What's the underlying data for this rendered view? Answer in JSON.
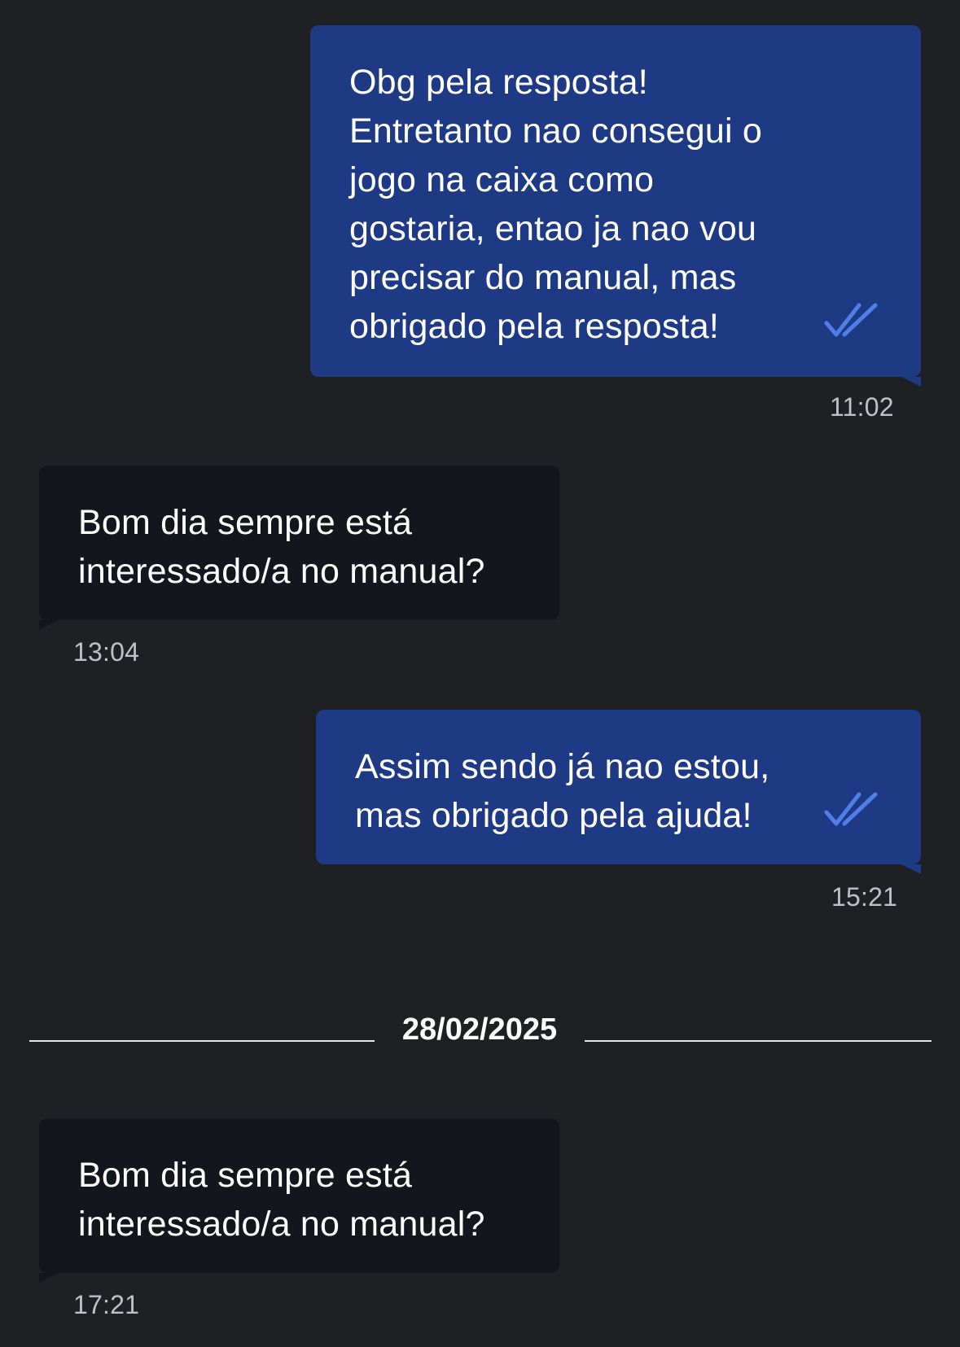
{
  "messages": [
    {
      "direction": "outgoing",
      "text": "Obg pela resposta! Entretanto nao consegui o jogo na caixa como gostaria, entao ja nao vou precisar do manual, mas obrigado pela resposta!",
      "time": "11:02",
      "status_icon": "double-check-icon"
    },
    {
      "direction": "incoming",
      "text": "Bom dia sempre está interessado/a no manual?",
      "time": "13:04"
    },
    {
      "direction": "outgoing",
      "text": "Assim sendo já nao estou, mas obrigado pela ajuda!",
      "time": "15:21",
      "status_icon": "double-check-icon"
    },
    {
      "direction": "incoming",
      "text": "Bom dia sempre está interessado/a no manual?",
      "time": "17:21"
    }
  ],
  "date_separator": "28/02/2025",
  "colors": {
    "background": "#1f2024",
    "outgoing_bubble": "#1f3a85",
    "incoming_bubble": "#14161d",
    "read_ticks": "#4f7fe6",
    "timestamp": "#bfc1c6"
  }
}
